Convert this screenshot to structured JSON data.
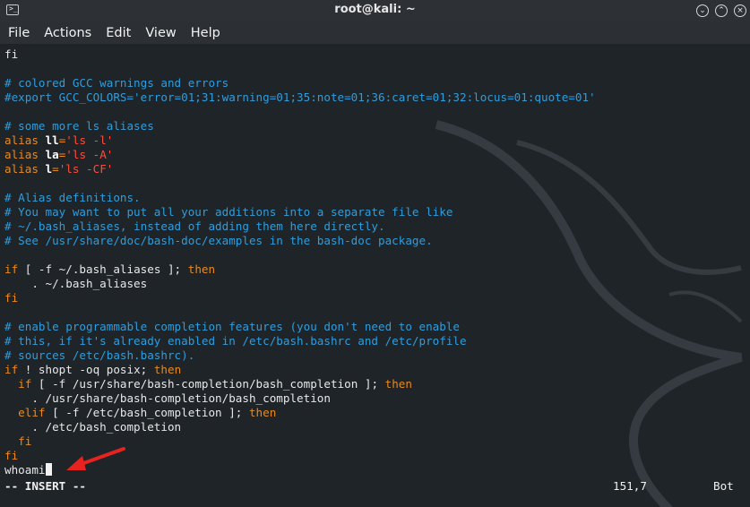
{
  "window": {
    "title": "root@kali: ~"
  },
  "menu": [
    "File",
    "Actions",
    "Edit",
    "View",
    "Help"
  ],
  "lines": {
    "l1": "fi",
    "l2": "# colored GCC warnings and errors",
    "l3": "#export GCC_COLORS='error=01;31:warning=01;35:note=01;36:caret=01;32:locus=01:quote=01'",
    "l4": "# some more ls aliases",
    "l5a": "alias",
    "l5b": "ll",
    "l5c": "=",
    "l5d": "'ls -l'",
    "l6a": "alias",
    "l6b": "la",
    "l6c": "=",
    "l6d": "'ls -A'",
    "l7a": "alias",
    "l7b": "l",
    "l7c": "=",
    "l7d": "'ls -CF'",
    "l8": "# Alias definitions.",
    "l9": "# You may want to put all your additions into a separate file like",
    "l10": "# ~/.bash_aliases, instead of adding them here directly.",
    "l11": "# See /usr/share/doc/bash-doc/examples in the bash-doc package.",
    "l12a": "if",
    "l12b": " [ -f ~/.bash_aliases ]; ",
    "l12c": "then",
    "l13": "    . ~/.bash_aliases",
    "l14": "fi",
    "l15": "# enable programmable completion features (you don't need to enable",
    "l16": "# this, if it's already enabled in /etc/bash.bashrc and /etc/profile",
    "l17": "# sources /etc/bash.bashrc).",
    "l18a": "if",
    "l18b": " ! shopt -oq posix; ",
    "l18c": "then",
    "l19a": "  if",
    "l19b": " [ -f /usr/share/bash-completion/bash_completion ]; ",
    "l19c": "then",
    "l20": "    . /usr/share/bash-completion/bash_completion",
    "l21a": "  elif",
    "l21b": " [ -f /etc/bash_completion ]; ",
    "l21c": "then",
    "l22": "    . /etc/bash_completion",
    "l23": "  fi",
    "l24": "fi",
    "l25": "whoami"
  },
  "status": {
    "mode": "-- INSERT --",
    "position": "151,7",
    "scroll": "Bot"
  },
  "colors": {
    "background": "#1f2428",
    "comment": "#2f9ddc",
    "keyword": "#e88a1f",
    "string": "#ff4d39",
    "arrow": "#e8231f"
  }
}
